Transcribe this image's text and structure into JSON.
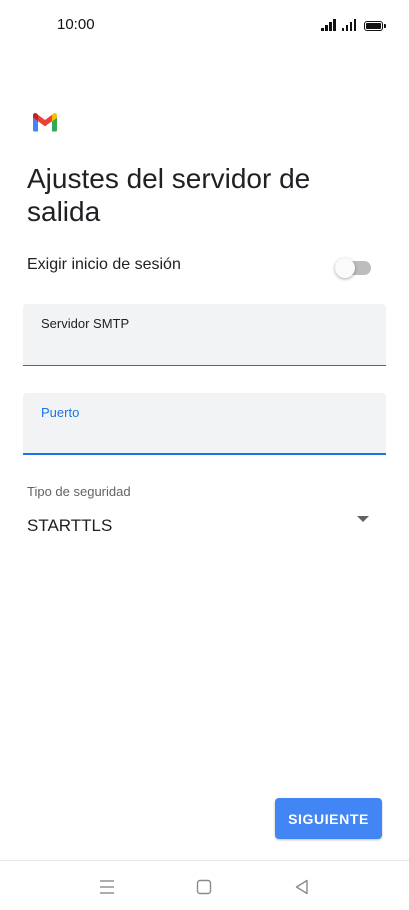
{
  "status_bar": {
    "time": "10:00"
  },
  "app": {
    "logo_icon": "gmail-logo-icon"
  },
  "page": {
    "title": "Ajustes del servidor de salida"
  },
  "login_toggle": {
    "label": "Exigir inicio de sesión",
    "enabled": false
  },
  "smtp_field": {
    "label": "Servidor SMTP",
    "value": ""
  },
  "port_field": {
    "label": "Puerto",
    "value": ""
  },
  "security": {
    "label": "Tipo de seguridad",
    "selected": "STARTTLS"
  },
  "actions": {
    "next_label": "SIGUIENTE"
  },
  "nav_bar": {
    "icons": [
      "menu-icon",
      "home-icon",
      "back-icon"
    ]
  },
  "colors": {
    "accent": "#1a73e8",
    "button": "#4285f4",
    "field_bg": "#f1f3f4",
    "text": "#202124"
  }
}
